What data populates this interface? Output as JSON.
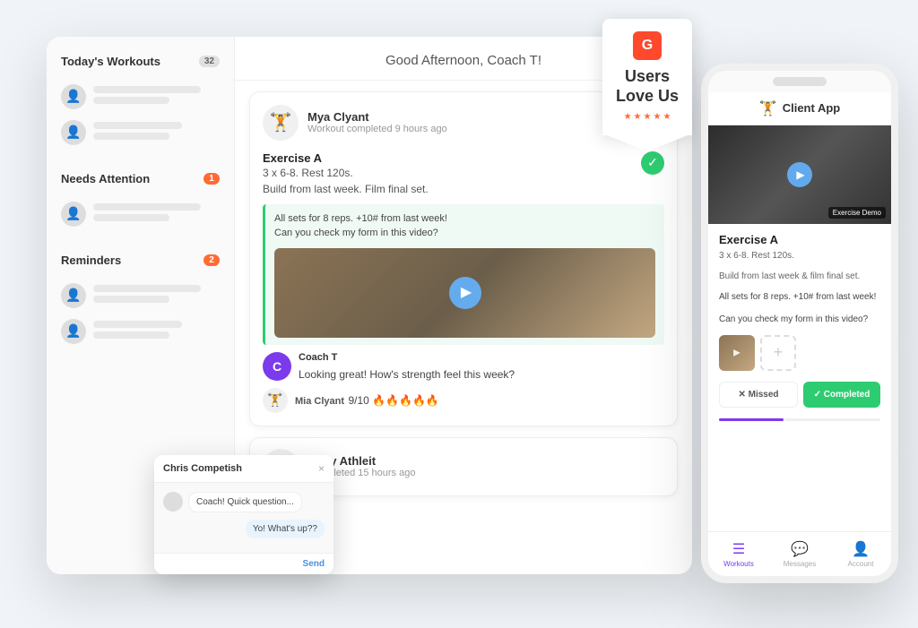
{
  "badge": {
    "g2_label": "G",
    "title_line1": "Users",
    "title_line2": "Love Us",
    "stars": [
      "★",
      "★",
      "★",
      "★",
      "★"
    ]
  },
  "desktop": {
    "greeting": "Good Afternoon, Coach T!",
    "sidebar": {
      "sections": [
        {
          "title": "Today's Workouts",
          "badge": "32",
          "items": [
            {
              "avatar": "🏃",
              "line1_width": "80%",
              "line2_width": "60%"
            },
            {
              "avatar": "🏃",
              "line1_width": "75%",
              "line2_width": "55%"
            }
          ]
        },
        {
          "title": "Needs Attention",
          "badge": "1",
          "badge_color": "orange",
          "items": [
            {
              "avatar": "🏃",
              "line1_width": "78%",
              "line2_width": "50%"
            }
          ]
        },
        {
          "title": "Reminders",
          "badge": "2",
          "badge_color": "orange",
          "items": [
            {
              "avatar": "🏃",
              "line1_width": "82%",
              "line2_width": "58%"
            },
            {
              "avatar": "🏃",
              "line1_width": "72%",
              "line2_width": "48%"
            }
          ]
        }
      ]
    },
    "workout_card": {
      "user_name": "Mya Clyant",
      "user_status": "Workout completed 9 hours ago",
      "user_emoji": "🏋️",
      "exercise_title": "Exercise A",
      "exercise_details_line1": "3 x 6-8. Rest 120s.",
      "exercise_details_line2": "Build from last week. Film final set.",
      "comment_line1": "All sets for 8 reps. +10# from last week!",
      "comment_line2": "Can you check my form in this video?",
      "coach_name": "Coach T",
      "coach_message": "Looking great! How's strength feel this week?",
      "coach_initial": "C",
      "client_reply_name": "Mia Clyant",
      "client_reply_text": "9/10 🔥🔥🔥🔥🔥"
    },
    "workout_card2": {
      "user_name": "Andy Athleit",
      "user_status": "Completed 15 hours ago",
      "user_emoji": "🏋️"
    },
    "chat_popup": {
      "name": "Chris Competish",
      "close": "×",
      "message1": "Coach! Quick question...",
      "message2": "Yo! What's up??",
      "send_label": "Send"
    }
  },
  "mobile": {
    "header_icon": "🏋️",
    "header_title": "Client App",
    "video_label": "Exercise Demo",
    "exercise_title": "Exercise A",
    "exercise_detail_line1": "3 x 6-8. Rest 120s.",
    "exercise_detail_line2": "Build from last week & film final set.",
    "comment_line1": "All sets for 8 reps. +10# from last week!",
    "comment_line2": "Can you check my form in this video?",
    "btn_missed": "✕  Missed",
    "btn_completed": "✓  Completed",
    "nav": [
      {
        "icon": "☰",
        "label": "Workouts",
        "active": true
      },
      {
        "icon": "💬",
        "label": "Messages",
        "active": false
      },
      {
        "icon": "👤",
        "label": "Account",
        "active": false
      }
    ]
  }
}
